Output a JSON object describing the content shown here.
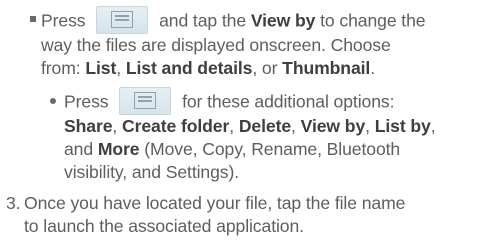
{
  "bullet1": {
    "press": "Press",
    "text_a": "and tap the",
    "view_by": "View by",
    "text_b": "to change the",
    "line2": "way the files are displayed onscreen. Choose",
    "from": "from:",
    "opt_list": "List",
    "comma1": ",",
    "opt_list_details": "List and details",
    "comma_or": ", or",
    "opt_thumbnail": "Thumbnail",
    "period": "."
  },
  "bullet2": {
    "press": "Press",
    "text_a": "for these additional options:",
    "share": "Share",
    "create_folder": "Create folder",
    "delete": "Delete",
    "view_by": "View by",
    "list_by": "List by",
    "comma": ",",
    "and": "and",
    "more": "More",
    "more_detail_1": "(Move, Copy, Rename, Bluetooth",
    "more_detail_2": "visibility, and Settings)."
  },
  "step3": {
    "number": "3.",
    "line1": "Once you have located your file, tap the file name",
    "line2": "to launch the associated application."
  },
  "icons": {
    "menu": "menu-key-icon"
  }
}
